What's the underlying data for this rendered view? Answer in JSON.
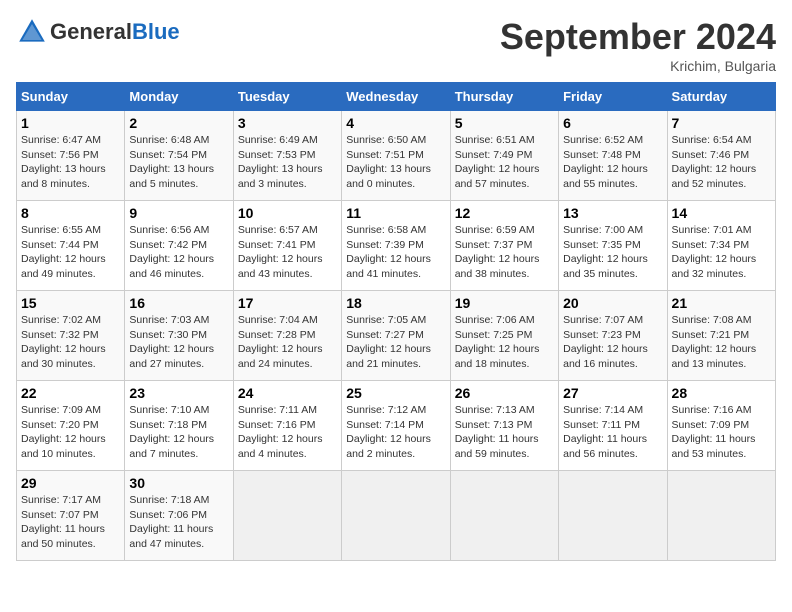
{
  "header": {
    "logo_general": "General",
    "logo_blue": "Blue",
    "month_title": "September 2024",
    "location": "Krichim, Bulgaria"
  },
  "days_of_week": [
    "Sunday",
    "Monday",
    "Tuesday",
    "Wednesday",
    "Thursday",
    "Friday",
    "Saturday"
  ],
  "weeks": [
    [
      {
        "day": 1,
        "sunrise": "6:47 AM",
        "sunset": "7:56 PM",
        "daylight": "13 hours and 8 minutes."
      },
      {
        "day": 2,
        "sunrise": "6:48 AM",
        "sunset": "7:54 PM",
        "daylight": "13 hours and 5 minutes."
      },
      {
        "day": 3,
        "sunrise": "6:49 AM",
        "sunset": "7:53 PM",
        "daylight": "13 hours and 3 minutes."
      },
      {
        "day": 4,
        "sunrise": "6:50 AM",
        "sunset": "7:51 PM",
        "daylight": "13 hours and 0 minutes."
      },
      {
        "day": 5,
        "sunrise": "6:51 AM",
        "sunset": "7:49 PM",
        "daylight": "12 hours and 57 minutes."
      },
      {
        "day": 6,
        "sunrise": "6:52 AM",
        "sunset": "7:48 PM",
        "daylight": "12 hours and 55 minutes."
      },
      {
        "day": 7,
        "sunrise": "6:54 AM",
        "sunset": "7:46 PM",
        "daylight": "12 hours and 52 minutes."
      }
    ],
    [
      {
        "day": 8,
        "sunrise": "6:55 AM",
        "sunset": "7:44 PM",
        "daylight": "12 hours and 49 minutes."
      },
      {
        "day": 9,
        "sunrise": "6:56 AM",
        "sunset": "7:42 PM",
        "daylight": "12 hours and 46 minutes."
      },
      {
        "day": 10,
        "sunrise": "6:57 AM",
        "sunset": "7:41 PM",
        "daylight": "12 hours and 43 minutes."
      },
      {
        "day": 11,
        "sunrise": "6:58 AM",
        "sunset": "7:39 PM",
        "daylight": "12 hours and 41 minutes."
      },
      {
        "day": 12,
        "sunrise": "6:59 AM",
        "sunset": "7:37 PM",
        "daylight": "12 hours and 38 minutes."
      },
      {
        "day": 13,
        "sunrise": "7:00 AM",
        "sunset": "7:35 PM",
        "daylight": "12 hours and 35 minutes."
      },
      {
        "day": 14,
        "sunrise": "7:01 AM",
        "sunset": "7:34 PM",
        "daylight": "12 hours and 32 minutes."
      }
    ],
    [
      {
        "day": 15,
        "sunrise": "7:02 AM",
        "sunset": "7:32 PM",
        "daylight": "12 hours and 30 minutes."
      },
      {
        "day": 16,
        "sunrise": "7:03 AM",
        "sunset": "7:30 PM",
        "daylight": "12 hours and 27 minutes."
      },
      {
        "day": 17,
        "sunrise": "7:04 AM",
        "sunset": "7:28 PM",
        "daylight": "12 hours and 24 minutes."
      },
      {
        "day": 18,
        "sunrise": "7:05 AM",
        "sunset": "7:27 PM",
        "daylight": "12 hours and 21 minutes."
      },
      {
        "day": 19,
        "sunrise": "7:06 AM",
        "sunset": "7:25 PM",
        "daylight": "12 hours and 18 minutes."
      },
      {
        "day": 20,
        "sunrise": "7:07 AM",
        "sunset": "7:23 PM",
        "daylight": "12 hours and 16 minutes."
      },
      {
        "day": 21,
        "sunrise": "7:08 AM",
        "sunset": "7:21 PM",
        "daylight": "12 hours and 13 minutes."
      }
    ],
    [
      {
        "day": 22,
        "sunrise": "7:09 AM",
        "sunset": "7:20 PM",
        "daylight": "12 hours and 10 minutes."
      },
      {
        "day": 23,
        "sunrise": "7:10 AM",
        "sunset": "7:18 PM",
        "daylight": "12 hours and 7 minutes."
      },
      {
        "day": 24,
        "sunrise": "7:11 AM",
        "sunset": "7:16 PM",
        "daylight": "12 hours and 4 minutes."
      },
      {
        "day": 25,
        "sunrise": "7:12 AM",
        "sunset": "7:14 PM",
        "daylight": "12 hours and 2 minutes."
      },
      {
        "day": 26,
        "sunrise": "7:13 AM",
        "sunset": "7:13 PM",
        "daylight": "11 hours and 59 minutes."
      },
      {
        "day": 27,
        "sunrise": "7:14 AM",
        "sunset": "7:11 PM",
        "daylight": "11 hours and 56 minutes."
      },
      {
        "day": 28,
        "sunrise": "7:16 AM",
        "sunset": "7:09 PM",
        "daylight": "11 hours and 53 minutes."
      }
    ],
    [
      {
        "day": 29,
        "sunrise": "7:17 AM",
        "sunset": "7:07 PM",
        "daylight": "11 hours and 50 minutes."
      },
      {
        "day": 30,
        "sunrise": "7:18 AM",
        "sunset": "7:06 PM",
        "daylight": "11 hours and 47 minutes."
      },
      null,
      null,
      null,
      null,
      null
    ]
  ]
}
